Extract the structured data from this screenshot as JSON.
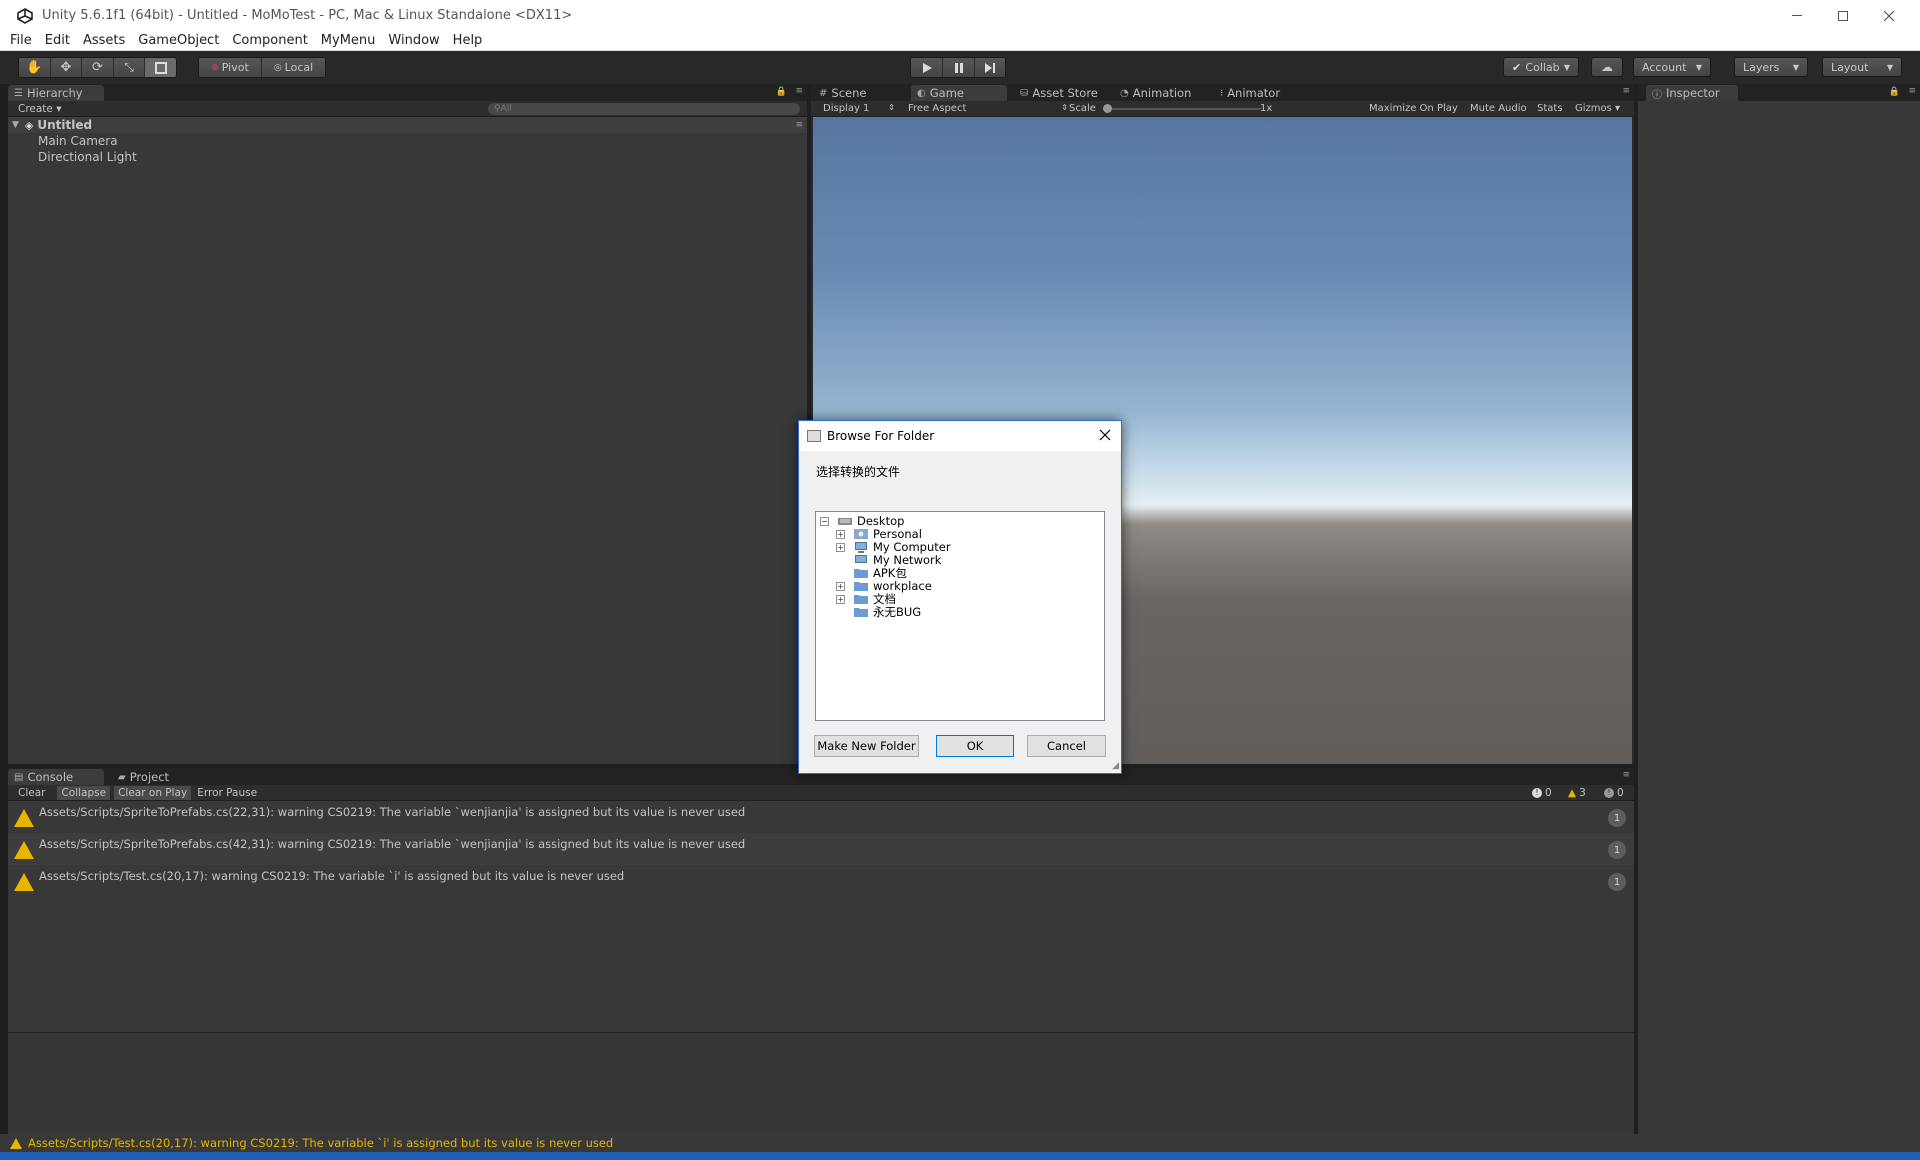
{
  "window": {
    "title": "Unity 5.6.1f1 (64bit) - Untitled - MoMoTest - PC, Mac & Linux Standalone <DX11>",
    "controls": [
      "minimize",
      "maximize",
      "close"
    ]
  },
  "menubar": {
    "items": [
      "File",
      "Edit",
      "Assets",
      "GameObject",
      "Component",
      "MyMenu",
      "Window",
      "Help"
    ]
  },
  "toolbar": {
    "tools": [
      "hand-tool",
      "move-tool",
      "rotate-tool",
      "scale-tool",
      "rect-tool"
    ],
    "pivot_label": "Pivot",
    "local_label": "Local",
    "collab_label": "Collab",
    "account_label": "Account",
    "layers_label": "Layers",
    "layout_label": "Layout"
  },
  "hierarchy": {
    "tab_label": "Hierarchy",
    "create_label": "Create",
    "search_placeholder": "All",
    "scene_name": "Untitled",
    "objects": [
      "Main Camera",
      "Directional Light"
    ]
  },
  "center": {
    "tabs": [
      "Scene",
      "Game",
      "Asset Store",
      "Animation",
      "Animator"
    ],
    "display_label": "Display 1",
    "aspect_label": "Free Aspect",
    "scale_label": "Scale",
    "scale_value": "1x",
    "options": [
      "Maximize On Play",
      "Mute Audio",
      "Stats",
      "Gizmos"
    ]
  },
  "inspector": {
    "tab_label": "Inspector"
  },
  "dialog": {
    "title": "Browse For Folder",
    "prompt": "选择转换的文件",
    "tree": [
      {
        "label": "Desktop",
        "expander": "−"
      },
      {
        "label": "Personal",
        "expander": "+"
      },
      {
        "label": "My Computer",
        "expander": "+"
      },
      {
        "label": "My Network",
        "expander": ""
      },
      {
        "label": "APK包",
        "expander": ""
      },
      {
        "label": "workplace",
        "expander": "+"
      },
      {
        "label": "文档",
        "expander": "+"
      },
      {
        "label": "永无BUG",
        "expander": ""
      }
    ],
    "make_folder_label": "Make New Folder",
    "ok_label": "OK",
    "cancel_label": "Cancel"
  },
  "console": {
    "tabs": [
      "Console",
      "Project"
    ],
    "buttons": [
      "Clear",
      "Collapse",
      "Clear on Play",
      "Error Pause"
    ],
    "counts": {
      "errors": "0",
      "warnings": "3",
      "messages": "0"
    },
    "rows": [
      {
        "text": "Assets/Scripts/SpriteToPrefabs.cs(22,31): warning CS0219: The variable `wenjianjia' is assigned but its value is never used",
        "count": "1"
      },
      {
        "text": "Assets/Scripts/SpriteToPrefabs.cs(42,31): warning CS0219: The variable `wenjianjia' is assigned but its value is never used",
        "count": "1"
      },
      {
        "text": "Assets/Scripts/Test.cs(20,17): warning CS0219: The variable `i' is assigned but its value is never used",
        "count": "1"
      }
    ]
  },
  "statusbar": {
    "text": "Assets/Scripts/Test.cs(20,17): warning CS0219: The variable `i' is assigned but its value is never used"
  },
  "colors": {
    "accent": "#2f6bd8",
    "warning": "#e8b400",
    "panel_bg": "#383838"
  }
}
